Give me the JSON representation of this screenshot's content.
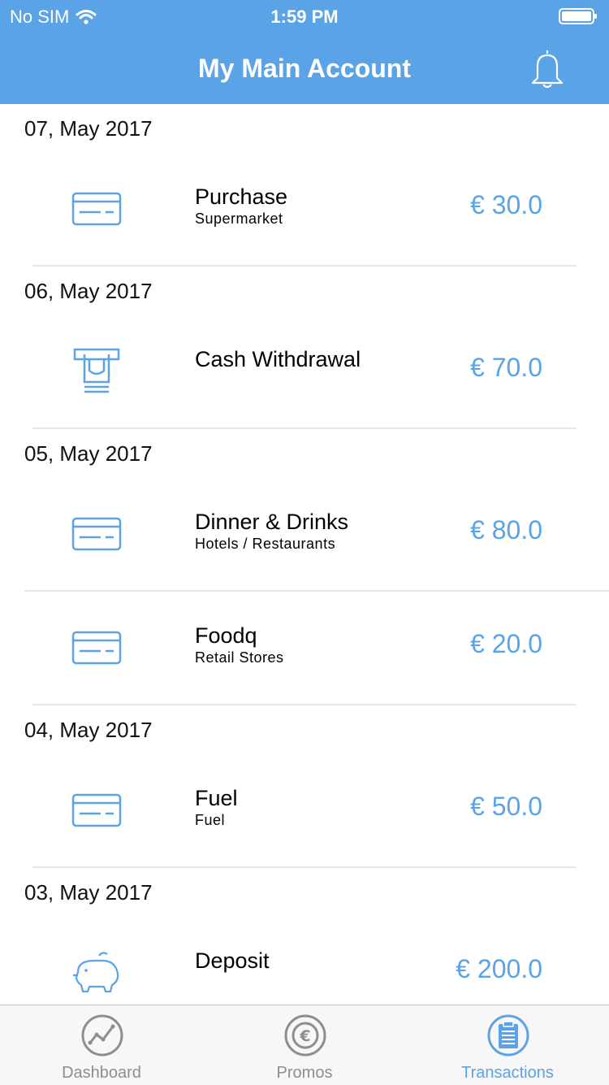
{
  "status": {
    "carrier": "No SIM",
    "time": "1:59 PM"
  },
  "header": {
    "title": "My Main Account",
    "bell_icon": "bell-icon"
  },
  "colors": {
    "accent": "#5aa3e6",
    "tab_inactive": "#8e8e8e"
  },
  "groups": [
    {
      "date": "07, May 2017",
      "transactions": [
        {
          "icon": "credit-card-icon",
          "title": "Purchase",
          "subtitle": "Supermarket",
          "amount": "€ 30.0"
        }
      ]
    },
    {
      "date": "06, May 2017",
      "transactions": [
        {
          "icon": "atm-icon",
          "title": "Cash Withdrawal",
          "subtitle": "",
          "amount": "€ 70.0"
        }
      ]
    },
    {
      "date": "05, May 2017",
      "transactions": [
        {
          "icon": "credit-card-icon",
          "title": "Dinner & Drinks",
          "subtitle": "Hotels / Restaurants",
          "amount": "€ 80.0"
        },
        {
          "icon": "credit-card-icon",
          "title": "Foodq",
          "subtitle": "Retail Stores",
          "amount": "€ 20.0"
        }
      ]
    },
    {
      "date": "04, May 2017",
      "transactions": [
        {
          "icon": "credit-card-icon",
          "title": "Fuel",
          "subtitle": "Fuel",
          "amount": "€ 50.0"
        }
      ]
    },
    {
      "date": "03, May 2017",
      "transactions": [
        {
          "icon": "piggy-bank-icon",
          "title": "Deposit",
          "subtitle": "",
          "amount": "€ 200.0"
        }
      ]
    }
  ],
  "tabs": [
    {
      "label": "Dashboard",
      "icon": "chart-line-icon",
      "active": false
    },
    {
      "label": "Promos",
      "icon": "euro-circle-icon",
      "active": false
    },
    {
      "label": "Transactions",
      "icon": "clipboard-list-icon",
      "active": true
    }
  ]
}
